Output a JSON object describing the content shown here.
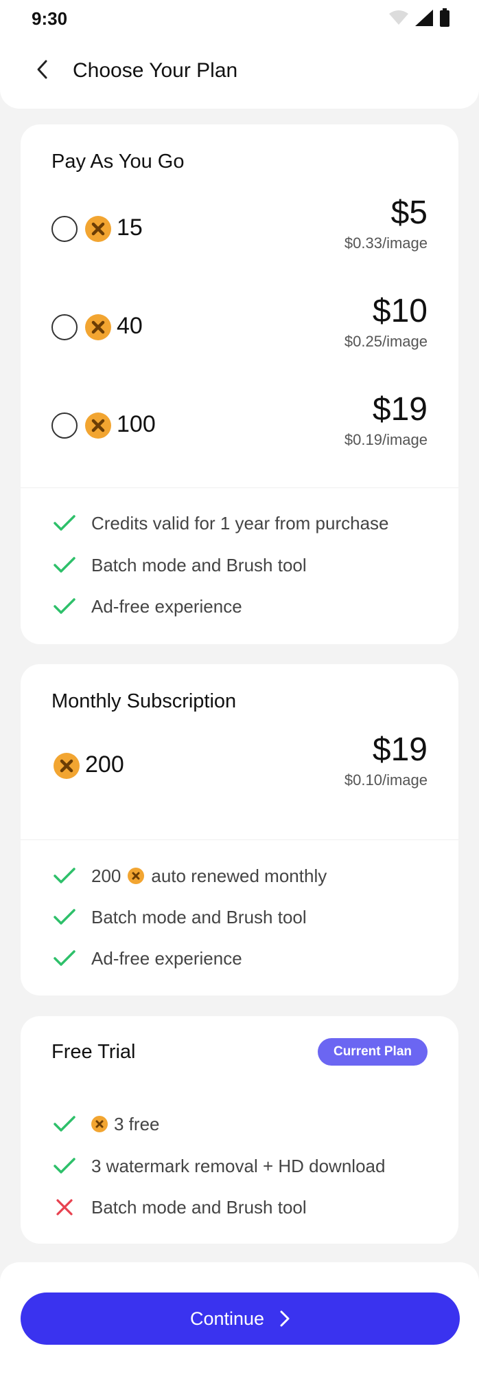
{
  "status_bar": {
    "time": "9:30",
    "icons": [
      "wifi-icon",
      "signal-icon",
      "battery-icon"
    ]
  },
  "header": {
    "title": "Choose Your Plan",
    "back_icon": "chevron-left-icon"
  },
  "pay_as_you_go": {
    "title": "Pay As You Go",
    "options": [
      {
        "credits": "15",
        "price": "$5",
        "per_image": "$0.33/image"
      },
      {
        "credits": "40",
        "price": "$10",
        "per_image": "$0.25/image"
      },
      {
        "credits": "100",
        "price": "$19",
        "per_image": "$0.19/image"
      }
    ],
    "features": [
      "Credits valid for 1 year from purchase",
      "Batch mode and Brush tool",
      "Ad-free experience"
    ]
  },
  "monthly": {
    "title": "Monthly Subscription",
    "credits": "200",
    "price": "$19",
    "per_image": "$0.10/image",
    "features": [
      {
        "prefix": "200",
        "suffix": "auto renewed monthly"
      },
      {
        "text": "Batch mode and Brush tool"
      },
      {
        "text": "Ad-free experience"
      }
    ]
  },
  "free_trial": {
    "title": "Free Trial",
    "badge": "Current Plan",
    "features": [
      {
        "text": "3 free",
        "included": true
      },
      {
        "text": "3 watermark removal + HD download",
        "included": true
      },
      {
        "text": "Batch mode and Brush tool",
        "included": false
      }
    ]
  },
  "footer": {
    "continue_label": "Continue"
  },
  "colors": {
    "accent": "#3a33ef",
    "badge": "#6b66f2",
    "check": "#2ec06a",
    "cross": "#e8414f",
    "coin": "#f2a531"
  }
}
